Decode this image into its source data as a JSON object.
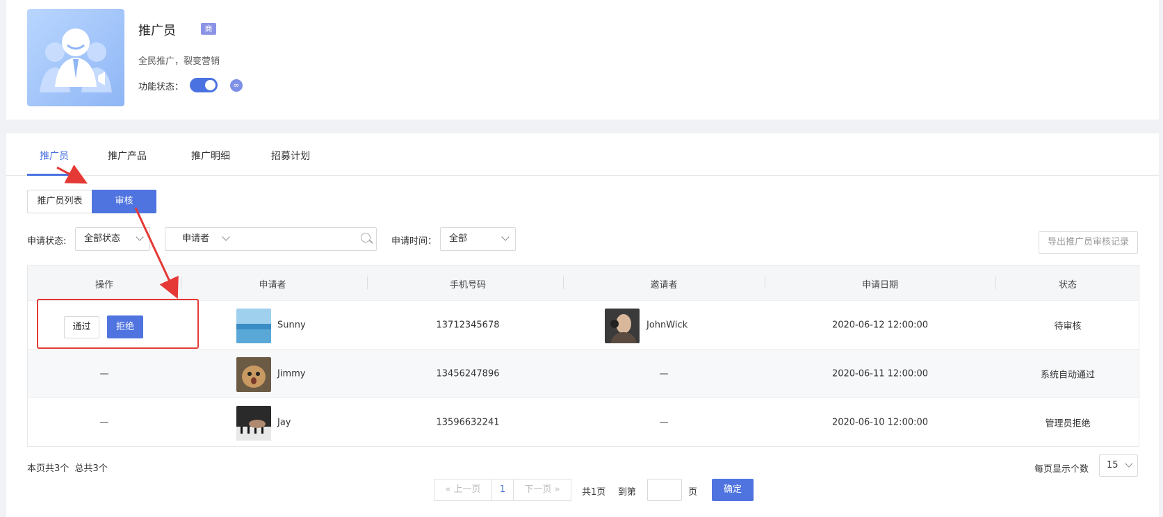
{
  "feature": {
    "title": "推广员",
    "badge": "商",
    "description": "全民推广，裂变营销",
    "status_label": "功能状态：",
    "enabled": true
  },
  "tabs": [
    {
      "label": "推广员",
      "active": true
    },
    {
      "label": "推广产品",
      "active": false
    },
    {
      "label": "推广明细",
      "active": false
    },
    {
      "label": "招募计划",
      "active": false
    }
  ],
  "segments": {
    "list_label": "推广员列表",
    "audit_label": "审核"
  },
  "filters": {
    "status_label": "申请状态:",
    "status_value": "全部状态",
    "applicant_type": "申请者",
    "search_value": "",
    "time_label": "申请时间：",
    "time_value": "全部",
    "export_label": "导出推广员审核记录"
  },
  "table": {
    "headers": [
      "操作",
      "申请者",
      "手机号码",
      "邀请者",
      "申请日期",
      "状态"
    ],
    "approve_label": "通过",
    "reject_label": "拒绝",
    "rows": [
      {
        "action": "",
        "applicant": "Sunny",
        "phone": "13712345678",
        "inviter": "JohnWick",
        "date": "2020-06-12 12:00:00",
        "status": "待审核"
      },
      {
        "action": "—",
        "applicant": "Jimmy",
        "phone": "13456247896",
        "inviter": "—",
        "date": "2020-06-11 12:00:00",
        "status": "系统自动通过"
      },
      {
        "action": "—",
        "applicant": "Jay",
        "phone": "13596632241",
        "inviter": "—",
        "date": "2020-06-10 12:00:00",
        "status": "管理员拒绝"
      }
    ]
  },
  "footer": {
    "page_count_text": "本页共3个",
    "total_text": "总共3个",
    "per_page_label": "每页显示个数",
    "per_page_value": "15",
    "prev_label": "上一页",
    "current_page": "1",
    "next_label": "下一页",
    "total_pages": "共1页",
    "goto_label": "到第",
    "page_unit": "页",
    "confirm_label": "确定"
  },
  "colors": {
    "accent": "#4f74e0",
    "annotation": "#e53935"
  }
}
